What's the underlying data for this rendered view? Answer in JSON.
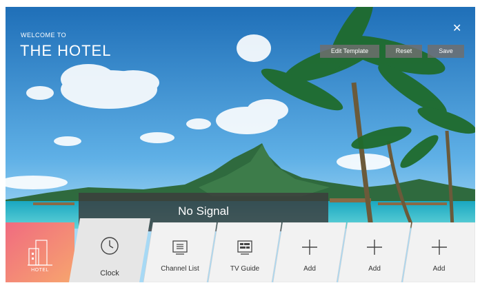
{
  "header": {
    "welcome": "WELCOME TO",
    "hotel_name": "THE HOTEL"
  },
  "toolbar": {
    "edit_label": "Edit Template",
    "reset_label": "Reset",
    "save_label": "Save",
    "close_icon": "close-icon"
  },
  "status": {
    "title": "No Signal",
    "subtitle": ""
  },
  "hotel_tile": {
    "label": "HOTEL",
    "icon": "hotel-building-icon"
  },
  "apps": [
    {
      "label": "Clock",
      "icon": "clock-icon"
    },
    {
      "label": "Channel List",
      "icon": "channel-list-icon"
    },
    {
      "label": "TV Guide",
      "icon": "tv-guide-icon"
    },
    {
      "label": "Add",
      "icon": "plus-icon"
    },
    {
      "label": "Add",
      "icon": "plus-icon"
    },
    {
      "label": "Add",
      "icon": "plus-icon"
    }
  ],
  "colors": {
    "sky_top": "#2a7fc6",
    "sky_bottom": "#7cc3ee",
    "sea": "#25b3c7",
    "hotel_tile_start": "#f06b80",
    "hotel_tile_end": "#f7a56e",
    "tile_bg": "#f2f2f2",
    "tile_selected_bg": "#e4e4e4"
  }
}
